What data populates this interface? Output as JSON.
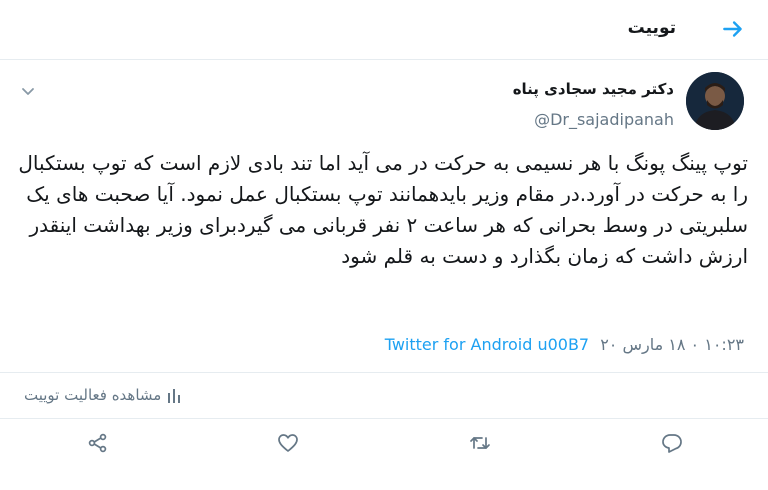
{
  "header": {
    "title": "توییت"
  },
  "author": {
    "name": "دکتر مجید سجادی پناه",
    "handle": "@Dr_sajadipanah"
  },
  "tweet": {
    "text": "توپ پینگ پونگ با هر نسیمی به حرکت در می آید اما تند بادی لازم است که توپ بستکبال را به حرکت در آورد.در مقام وزیر بایدهمانند توپ بستکبال عمل نمود. آیا صحبت های یک سلبریتی در وسط بحرانی که هر ساعت ۲ نفر قربانی می گیردبرای وزیر بهداشت اینقدر ارزش داشت که زمان بگذارد و دست به قلم شود",
    "timestamp": "۱۰:۲۳ ۰ ۱۸ مارس ۲۰",
    "client": "Twitter for Android u00B7"
  },
  "activity": {
    "label": "مشاهده فعالیت توییت"
  },
  "icons": {
    "back": "arrow-right-icon",
    "caret": "chevron-down-icon",
    "activity": "bar-chart-icon",
    "share": "share-icon",
    "like": "heart-icon",
    "retweet": "retweet-icon",
    "reply": "reply-icon"
  },
  "colors": {
    "accent": "#1da1f2",
    "muted": "#657786",
    "text": "#14171a",
    "border": "#e6ecf0"
  }
}
